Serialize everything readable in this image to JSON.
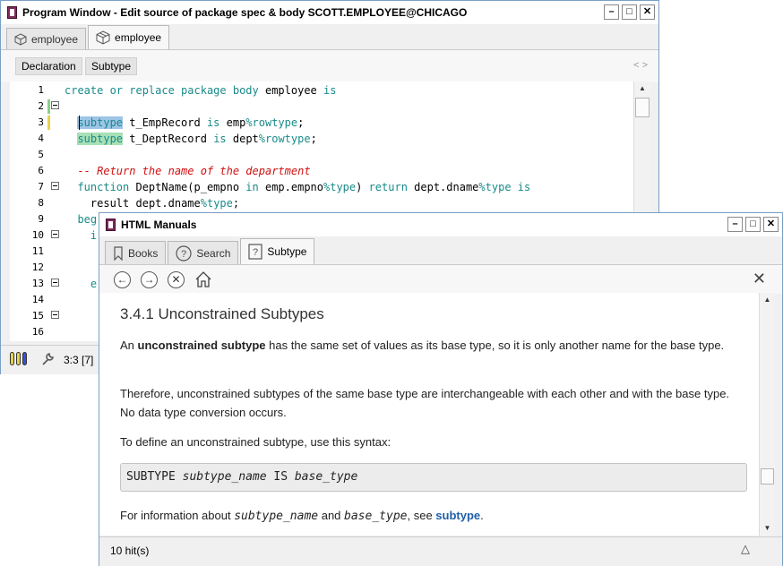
{
  "program_window": {
    "title": "Program Window - Edit source of package spec & body SCOTT.EMPLOYEE@CHICAGO",
    "tabs": [
      {
        "label": "employee"
      },
      {
        "label": "employee"
      }
    ],
    "subtabs": {
      "declaration": "Declaration",
      "subtype": "Subtype",
      "nav": "< >"
    },
    "line_numbers": [
      "1",
      "2",
      "3",
      "4",
      "5",
      "6",
      "7",
      "8",
      "9",
      "10",
      "11",
      "12",
      "13",
      "14",
      "15",
      "16"
    ],
    "code": {
      "l1_a": "create or replace package body",
      "l1_b": " employee ",
      "l1_c": "is",
      "l3_a": "subtype",
      "l3_b": " t_EmpRecord ",
      "l3_c": "is",
      "l3_d": " emp",
      "l3_e": "%rowtype",
      "l3_f": ";",
      "l4_a": "subtype",
      "l4_b": " t_DeptRecord ",
      "l4_c": "is",
      "l4_d": " dept",
      "l4_e": "%rowtype",
      "l4_f": ";",
      "l6": "-- Return the name of the department",
      "l7_a": "function",
      "l7_b": " DeptName(p_empno ",
      "l7_c": "in",
      "l7_d": " emp.empno",
      "l7_e": "%type",
      "l7_f": ") ",
      "l7_g": "return",
      "l7_h": " dept.dname",
      "l7_i": "%type",
      "l7_j": " ",
      "l7_k": "is",
      "l8_a": "result",
      "l8_b": " dept.dname",
      "l8_c": "%type",
      "l8_d": ";",
      "l9": "beg",
      "l10": "i",
      "l13": "e"
    },
    "status": {
      "position": "3:3 [7]"
    }
  },
  "help_window": {
    "title": "HTML Manuals",
    "tabs": {
      "books": "Books",
      "search": "Search",
      "subtype": "Subtype"
    },
    "heading": "3.4.1 Unconstrained Subtypes",
    "p1": {
      "a": "An ",
      "b": "unconstrained subtype",
      "c": " has the same set of values as its base type, so it is only another name for the base type."
    },
    "p2": "Therefore, unconstrained subtypes of the same base type are interchangeable with each other and with the base type. No data type conversion occurs.",
    "p3": "To define an unconstrained subtype, use this syntax:",
    "syntax": {
      "a": "SUBTYPE ",
      "b": "subtype_name",
      "c": " IS ",
      "d": "base_type"
    },
    "p4": {
      "a": "For information about ",
      "b": "subtype_name",
      "c": " and ",
      "d": "base_type",
      "e": ", see ",
      "f": "subtype",
      "g": "."
    },
    "status": {
      "hits": "10 hit(s)"
    }
  }
}
